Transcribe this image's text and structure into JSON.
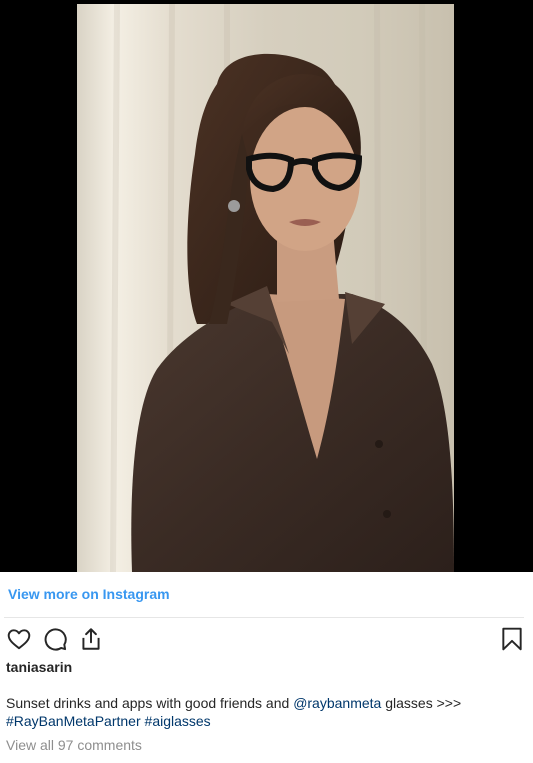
{
  "post": {
    "view_more_label": "View more on Instagram",
    "username": "taniasarin",
    "caption": {
      "text_before_mention": "Sunset drinks and apps with good friends and",
      "mention": "@raybanmeta",
      "text_after_mention": "glasses >>>",
      "hashtag_1": "#RayBanMetaPartner",
      "hashtag_2": "#aiglasses"
    },
    "comments_label": "View all 97 comments"
  },
  "icons": {
    "like": "heart-icon",
    "comment": "comment-icon",
    "share": "share-icon",
    "save": "bookmark-icon"
  },
  "colors": {
    "link_blue": "#3897f0",
    "mention_blue": "#00376b",
    "text": "#262626",
    "muted": "#8e8e8e"
  }
}
